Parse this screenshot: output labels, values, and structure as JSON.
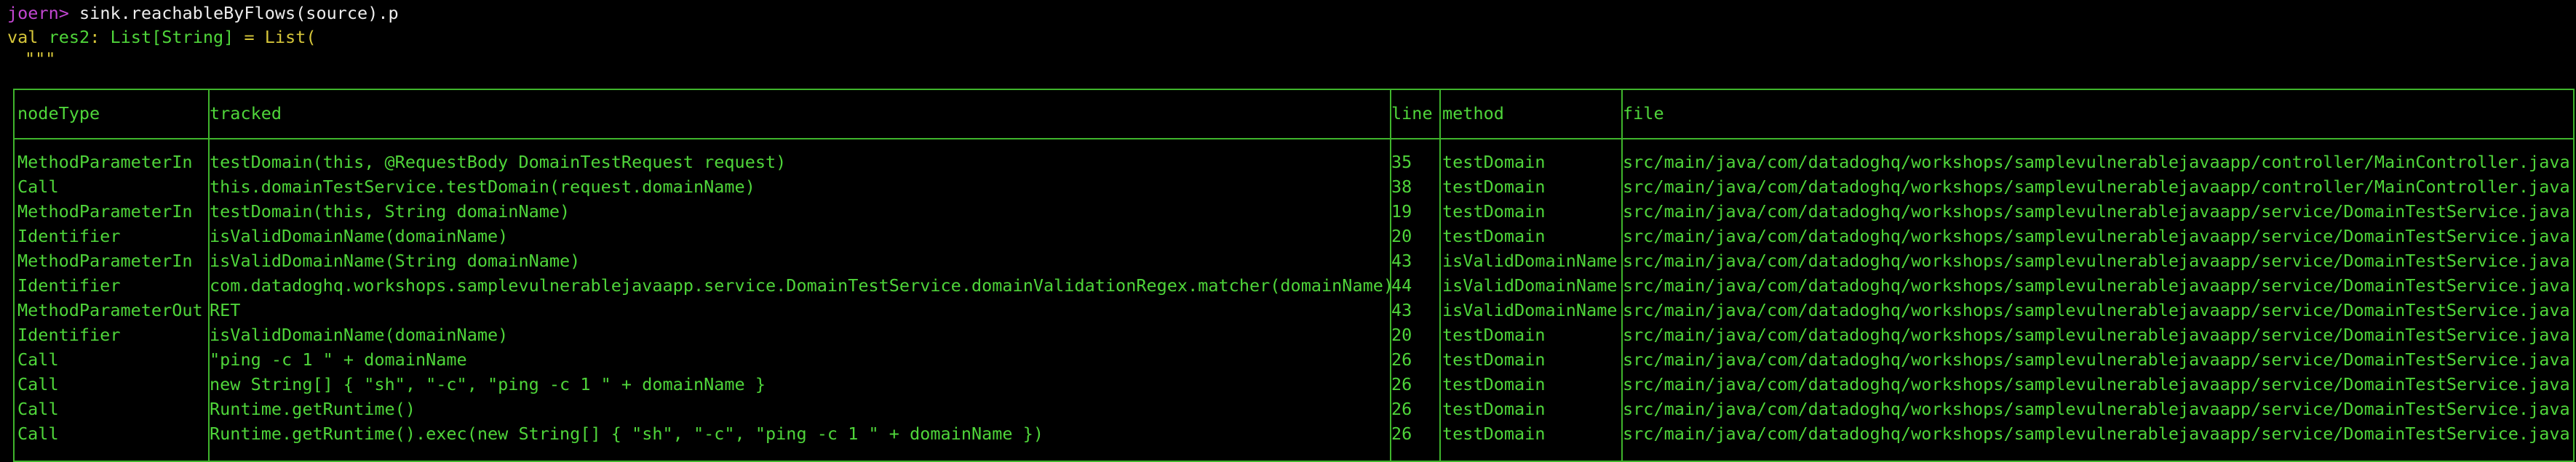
{
  "terminal": {
    "prompt": "joern>",
    "command": " sink.reachableByFlows(source).p",
    "result_line": {
      "val": "val",
      "name": "res2",
      "colon": ":",
      "type": "List[String]",
      "eq": "=",
      "list_open": "List("
    },
    "string_open": "\"\"\""
  },
  "table": {
    "headers": [
      "nodeType",
      "tracked",
      "line",
      "method",
      "file"
    ],
    "rows": [
      [
        "MethodParameterIn",
        "testDomain(this, @RequestBody DomainTestRequest request)",
        "35",
        "testDomain",
        "src/main/java/com/datadoghq/workshops/samplevulnerablejavaapp/controller/MainController.java"
      ],
      [
        "Call",
        "this.domainTestService.testDomain(request.domainName)",
        "38",
        "testDomain",
        "src/main/java/com/datadoghq/workshops/samplevulnerablejavaapp/controller/MainController.java"
      ],
      [
        "MethodParameterIn",
        "testDomain(this, String domainName)",
        "19",
        "testDomain",
        "src/main/java/com/datadoghq/workshops/samplevulnerablejavaapp/service/DomainTestService.java"
      ],
      [
        "Identifier",
        "isValidDomainName(domainName)",
        "20",
        "testDomain",
        "src/main/java/com/datadoghq/workshops/samplevulnerablejavaapp/service/DomainTestService.java"
      ],
      [
        "MethodParameterIn",
        "isValidDomainName(String domainName)",
        "43",
        "isValidDomainName",
        "src/main/java/com/datadoghq/workshops/samplevulnerablejavaapp/service/DomainTestService.java"
      ],
      [
        "Identifier",
        "com.datadoghq.workshops.samplevulnerablejavaapp.service.DomainTestService.domainValidationRegex.matcher(domainName)",
        "44",
        "isValidDomainName",
        "src/main/java/com/datadoghq/workshops/samplevulnerablejavaapp/service/DomainTestService.java"
      ],
      [
        "MethodParameterOut",
        "RET",
        "43",
        "isValidDomainName",
        "src/main/java/com/datadoghq/workshops/samplevulnerablejavaapp/service/DomainTestService.java"
      ],
      [
        "Identifier",
        "isValidDomainName(domainName)",
        "20",
        "testDomain",
        "src/main/java/com/datadoghq/workshops/samplevulnerablejavaapp/service/DomainTestService.java"
      ],
      [
        "Call",
        "\"ping -c 1 \" + domainName",
        "26",
        "testDomain",
        "src/main/java/com/datadoghq/workshops/samplevulnerablejavaapp/service/DomainTestService.java"
      ],
      [
        "Call",
        "new String[] { \"sh\", \"-c\", \"ping -c 1 \" + domainName }",
        "26",
        "testDomain",
        "src/main/java/com/datadoghq/workshops/samplevulnerablejavaapp/service/DomainTestService.java"
      ],
      [
        "Call",
        "Runtime.getRuntime()",
        "26",
        "testDomain",
        "src/main/java/com/datadoghq/workshops/samplevulnerablejavaapp/service/DomainTestService.java"
      ],
      [
        "Call",
        "Runtime.getRuntime().exec(new String[] { \"sh\", \"-c\", \"ping -c 1 \" + domainName })",
        "26",
        "testDomain",
        "src/main/java/com/datadoghq/workshops/samplevulnerablejavaapp/service/DomainTestService.java"
      ]
    ]
  },
  "colors": {
    "background": "#000000",
    "text": "#4fd53a",
    "prompt": "#c246d1",
    "command": "#ededed",
    "keyword": "#d6c63a",
    "border": "#3fb52c"
  }
}
